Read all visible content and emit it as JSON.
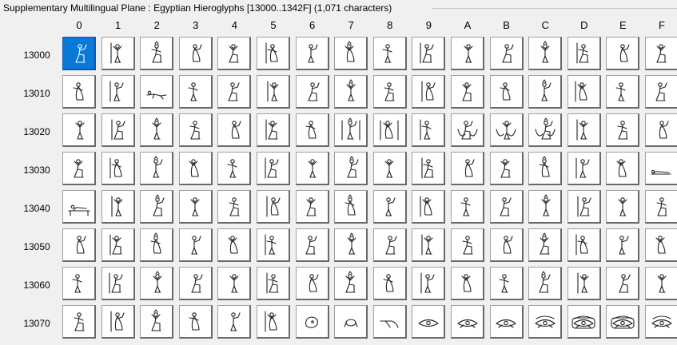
{
  "groupbox": {
    "title": "Supplementary Multilingual Plane : Egyptian Hieroglyphs [13000..1342F] (1,071 characters)"
  },
  "grid": {
    "columns": [
      "0",
      "1",
      "2",
      "3",
      "4",
      "5",
      "6",
      "7",
      "8",
      "9",
      "A",
      "B",
      "C",
      "D",
      "E",
      "F"
    ],
    "rows": [
      "13000",
      "13010",
      "13020",
      "13030",
      "13040",
      "13050",
      "13060",
      "13070"
    ],
    "selected_row": 0,
    "selected_col": 0,
    "glyph_icons": [
      [
        "seated-man-glyph",
        "man-hand-to-mouth-glyph",
        "man-striking-glyph",
        "man-with-stick-glyph",
        "man-raising-arms-glyph",
        "man-with-basket-glyph",
        "man-kneeling-glyph",
        "man-bending-glyph",
        "man-hoeing-glyph",
        "man-sitting-glyph",
        "man-holding-glyph",
        "man-arm-raised-glyph",
        "man-with-staff-glyph",
        "man-offering-glyph",
        "man-with-pot-glyph",
        "man-kneeling-offering-glyph"
      ],
      [
        "man-falling-glyph",
        "man-fallen-glyph",
        "man-lying-glyph",
        "man-standing-staff-glyph",
        "man-seated-arms-glyph",
        "man-pointing-glyph",
        "man-dancing-glyph",
        "man-standing-glyph",
        "man-with-pole-glyph",
        "man-standing-holding-glyph",
        "man-seated-throne-glyph",
        "man-with-crook-glyph",
        "man-walking-glyph",
        "man-striding-glyph",
        "man-waving-glyph",
        "man-arms-out-glyph"
      ],
      [
        "man-arms-up-glyph",
        "man-on-stand-glyph",
        "man-with-sign-glyph",
        "man-with-scepter-glyph",
        "man-holding-staff-glyph",
        "man-holding-object-glyph",
        "man-with-flag-glyph",
        "man-with-column-glyph",
        "man-between-columns-glyph",
        "man-carrying-basket-glyph",
        "man-carrying-yoke-glyph",
        "god-with-bowls-glyph",
        "men-with-canopy-glyph",
        "seated-god-glyph",
        "seated-god-staff-glyph",
        "kneeling-god-glyph"
      ],
      [
        "god-standing-feather-glyph",
        "god-with-feather-glyph",
        "god-holding-ankh-glyph",
        "god-with-wand-glyph",
        "god-arm-raised-glyph",
        "god-with-scepter-glyph",
        "god-with-staff-glyph",
        "god-striding-glyph",
        "god-seated-glyph",
        "god-kneeling-glyph",
        "god-seated-arm-glyph",
        "god-on-throne-glyph",
        "god-offering-glyph",
        "god-holding-glyph",
        "mummy-standing-glyph",
        "man-lying-flat-glyph"
      ],
      [
        "man-on-bed-glyph",
        "man-seated-child-glyph",
        "man-with-sceptre-glyph",
        "man-with-harp-glyph",
        "man-dancing-ribbon-glyph",
        "man-with-fan-glyph",
        "man-carrying-jar-glyph",
        "man-standing-robe-glyph",
        "man-at-table-glyph",
        "man-kneeling-bowl-glyph",
        "man-standing-arms-glyph",
        "man-holding-bread-glyph",
        "man-praying-glyph",
        "man-arms-forward-glyph",
        "man-seated-arms-up-glyph",
        "man-kneeling-arms-up-glyph"
      ],
      [
        "woman-seated-glyph",
        "woman-kneeling-glyph",
        "woman-with-child-glyph",
        "woman-nursing-glyph",
        "woman-giving-birth-glyph",
        "woman-seated-robe-glyph",
        "woman-with-vessel-glyph",
        "woman-dancing-glyph",
        "woman-arms-up-glyph",
        "woman-standing-glyph",
        "god-seated-headdress-glyph",
        "god-seated-ibis-glyph",
        "god-seated-falcon-glyph",
        "god-seated-jackal-glyph",
        "god-seated-ram-glyph",
        "god-seated-crown-glyph"
      ],
      [
        "god-seated-horns-glyph",
        "god-seated-disc-glyph",
        "god-seated-uraeus-glyph",
        "god-with-ankh-glyph",
        "god-seated-feathers-glyph",
        "goddess-seated-glyph",
        "god-with-vulture-glyph",
        "god-with-double-crown-glyph",
        "god-seated-plume-glyph",
        "god-kneeling-rays-glyph",
        "god-seated-flail-glyph",
        "god-seated-long-glyph",
        "goddess-wings-glyph",
        "god-seated-cap-glyph",
        "god-seated-staff2-glyph",
        "god-standing-staff2-glyph"
      ],
      [
        "mummy-upright-glyph",
        "mummy-case-glyph",
        "king-on-throne-glyph",
        "god-wearing-crown-glyph",
        "kneeling-king-glyph",
        "king-with-bow-glyph",
        "head-profile-glyph",
        "face-front-glyph",
        "hair-lock-glyph",
        "eye-glyph",
        "eye-painted-glyph",
        "eye-with-brow-glyph",
        "eye-weeping-glyph",
        "eye-cartouche-glyph",
        "eye-in-frame-glyph",
        "eye-with-legs-glyph"
      ]
    ]
  }
}
